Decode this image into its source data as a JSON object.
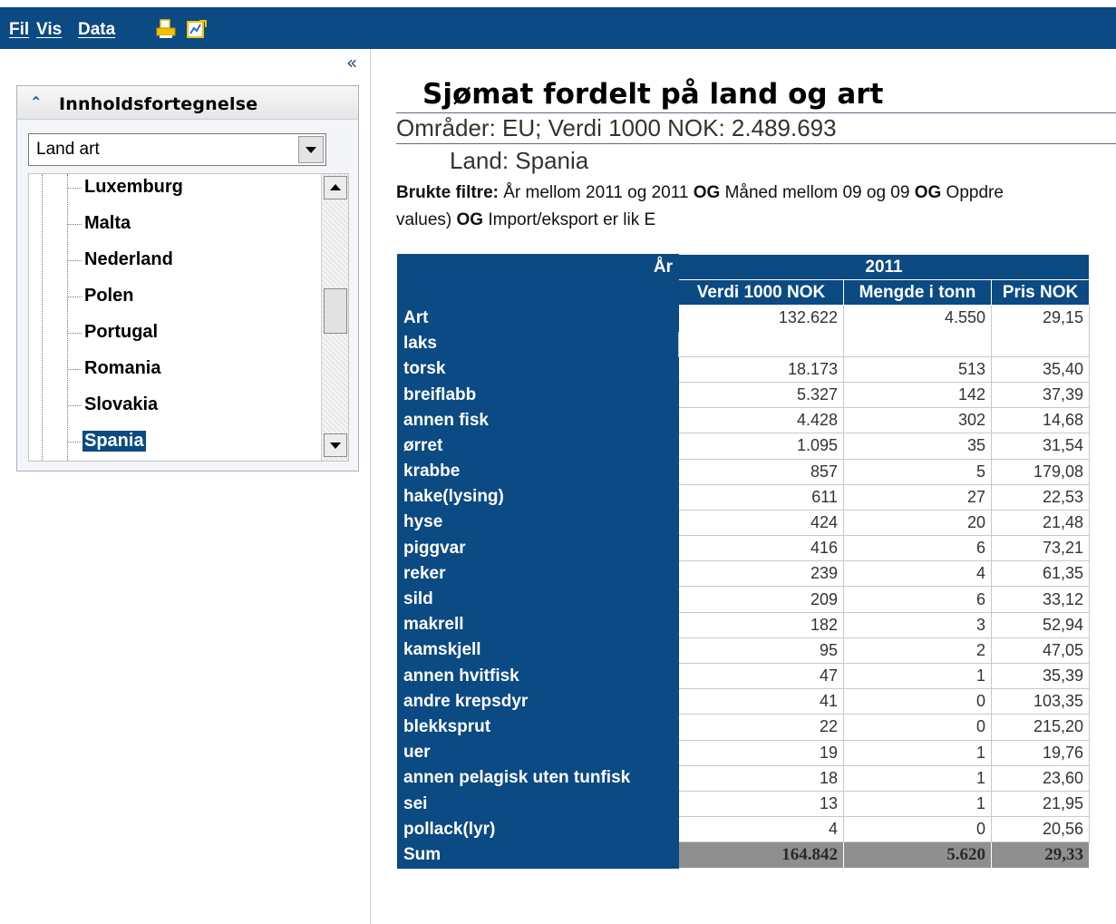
{
  "menu": {
    "items": [
      "Fil",
      "Vis",
      "Data"
    ]
  },
  "toolbar": {
    "icons": [
      "print-icon",
      "edit-report-icon"
    ]
  },
  "sidebar": {
    "collapse_glyph": "«",
    "toc_title": "Innholdsfortegnelse",
    "select_value": "Land art",
    "tree_items": [
      "Luxemburg",
      "Malta",
      "Nederland",
      "Polen",
      "Portugal",
      "Romania",
      "Slovakia",
      "Spania"
    ],
    "selected_item": "Spania"
  },
  "report": {
    "title": "Sjømat fordelt på land og art",
    "subtitle": "Områder: EU; Verdi 1000 NOK: 2.489.693",
    "land": "Land: Spania",
    "filter_label": "Brukte filtre:",
    "filter_parts": [
      " År mellom 2011 og 2011 ",
      "OG",
      " Måned mellom 09 og 09 ",
      "OG",
      " Oppdre"
    ],
    "filter_line2_a": "values) ",
    "filter_line2_og": "OG",
    "filter_line2_b": " Import/eksport er lik E"
  },
  "table": {
    "corner_label": "År",
    "year": "2011",
    "columns": [
      "Verdi 1000 NOK",
      "Mengde i tonn",
      "Pris NOK"
    ],
    "row_header": "Art",
    "rows": [
      {
        "label": "laks",
        "values": [
          "132.622",
          "4.550",
          "29,15"
        ]
      },
      {
        "label": "torsk",
        "values": [
          "18.173",
          "513",
          "35,40"
        ]
      },
      {
        "label": "breiflabb",
        "values": [
          "5.327",
          "142",
          "37,39"
        ]
      },
      {
        "label": "annen fisk",
        "values": [
          "4.428",
          "302",
          "14,68"
        ]
      },
      {
        "label": "ørret",
        "values": [
          "1.095",
          "35",
          "31,54"
        ]
      },
      {
        "label": "krabbe",
        "values": [
          "857",
          "5",
          "179,08"
        ]
      },
      {
        "label": "hake(lysing)",
        "values": [
          "611",
          "27",
          "22,53"
        ]
      },
      {
        "label": "hyse",
        "values": [
          "424",
          "20",
          "21,48"
        ]
      },
      {
        "label": "piggvar",
        "values": [
          "416",
          "6",
          "73,21"
        ]
      },
      {
        "label": "reker",
        "values": [
          "239",
          "4",
          "61,35"
        ]
      },
      {
        "label": "sild",
        "values": [
          "209",
          "6",
          "33,12"
        ]
      },
      {
        "label": "makrell",
        "values": [
          "182",
          "3",
          "52,94"
        ]
      },
      {
        "label": "kamskjell",
        "values": [
          "95",
          "2",
          "47,05"
        ]
      },
      {
        "label": "annen hvitfisk",
        "values": [
          "47",
          "1",
          "35,39"
        ]
      },
      {
        "label": "andre krepsdyr",
        "values": [
          "41",
          "0",
          "103,35"
        ]
      },
      {
        "label": "blekksprut",
        "values": [
          "22",
          "0",
          "215,20"
        ]
      },
      {
        "label": "uer",
        "values": [
          "19",
          "1",
          "19,76"
        ]
      },
      {
        "label": "annen pelagisk uten tunfisk",
        "values": [
          "18",
          "1",
          "23,60"
        ]
      },
      {
        "label": "sei",
        "values": [
          "13",
          "1",
          "21,95"
        ]
      },
      {
        "label": "pollack(lyr)",
        "values": [
          "4",
          "0",
          "20,56"
        ]
      }
    ],
    "sum": {
      "label": "Sum",
      "values": [
        "164.842",
        "5.620",
        "29,33"
      ]
    }
  },
  "colors": {
    "brand_blue": "#0b4a82",
    "sum_gray": "#8f8f8f"
  }
}
